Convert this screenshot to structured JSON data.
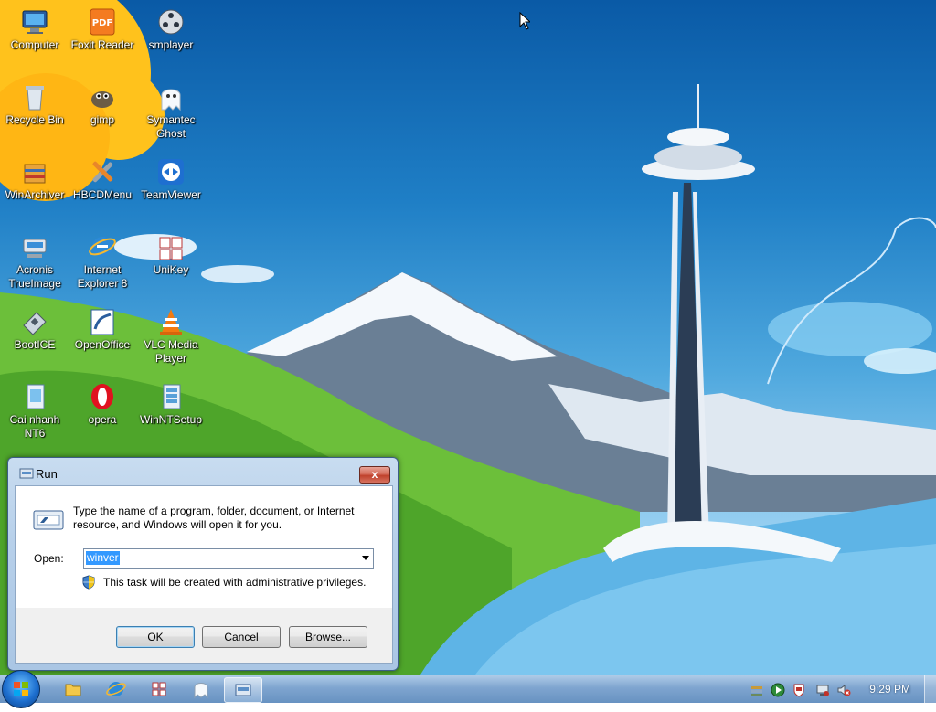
{
  "desktop": {
    "icons": [
      {
        "label": "Computer",
        "icon": "computer-icon"
      },
      {
        "label": "Foxit Reader",
        "icon": "pdf-icon"
      },
      {
        "label": "smplayer",
        "icon": "film-reel-icon"
      },
      {
        "label": "Recycle Bin",
        "icon": "recycle-bin-icon"
      },
      {
        "label": "gimp",
        "icon": "gimp-icon"
      },
      {
        "label": "Symantec\nGhost",
        "icon": "ghost-icon"
      },
      {
        "label": "WinArchiver",
        "icon": "archive-icon"
      },
      {
        "label": "HBCDMenu",
        "icon": "tools-icon"
      },
      {
        "label": "TeamViewer",
        "icon": "teamviewer-icon"
      },
      {
        "label": "Acronis\nTrueImage",
        "icon": "disk-icon"
      },
      {
        "label": "Internet\nExplorer 8",
        "icon": "internet-explorer-icon"
      },
      {
        "label": "UniKey",
        "icon": "keyboard-icon"
      },
      {
        "label": "BootICE",
        "icon": "boot-disk-icon"
      },
      {
        "label": "OpenOffice",
        "icon": "openoffice-icon"
      },
      {
        "label": "VLC Media\nPlayer",
        "icon": "vlc-cone-icon"
      },
      {
        "label": "Cai nhanh\nNT6",
        "icon": "installer-icon"
      },
      {
        "label": "opera",
        "icon": "opera-icon"
      },
      {
        "label": "WinNTSetup",
        "icon": "setup-icon"
      }
    ]
  },
  "run_dialog": {
    "title": "Run",
    "close_glyph": "x",
    "description": "Type the name of a program, folder, document, or Internet resource, and Windows will open it for you.",
    "open_label": "Open:",
    "open_value": "winver",
    "admin_note": "This task will be created with administrative privileges.",
    "buttons": {
      "ok": "OK",
      "cancel": "Cancel",
      "browse": "Browse..."
    }
  },
  "taskbar": {
    "pinned": [
      "folder-icon",
      "internet-explorer-icon",
      "keyboard-icon",
      "ghost-icon",
      "run-window-icon"
    ],
    "tray": [
      "network-stack-icon",
      "play-icon",
      "shield-flag-icon",
      "network-icon",
      "volume-muted-icon"
    ],
    "clock": "9:29 PM"
  },
  "colors": {
    "selection": "#3399ff",
    "close_button": "#c0422c",
    "label_text": "#ffffff"
  }
}
